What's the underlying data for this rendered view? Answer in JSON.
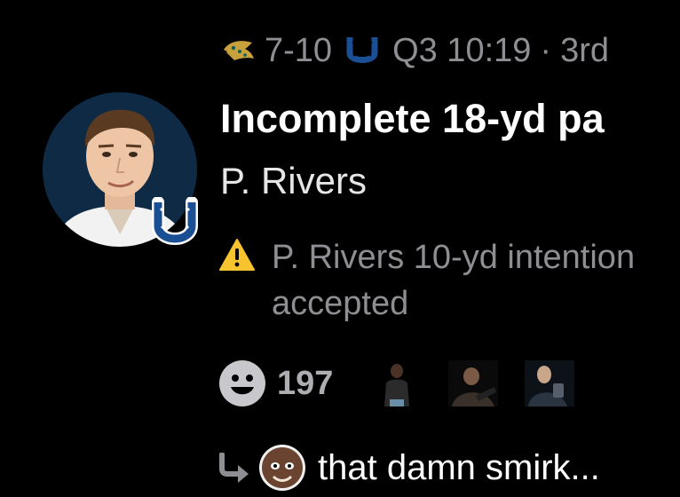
{
  "score": {
    "away_team_icon": "jaguars-logo-icon",
    "score_text": "7-10",
    "home_team_icon": "colts-horseshoe-icon",
    "quarter_clock": "Q3 10:19",
    "separator": "·",
    "down_text": "3rd"
  },
  "play": {
    "headline": "Incomplete 18-yd pa",
    "player_name": "P. Rivers",
    "player_avatar_icon": "player-headshot",
    "team_badge_icon": "colts-horseshoe-icon",
    "penalty_icon": "warning-icon",
    "penalty_line1": "P. Rivers 10-yd intention",
    "penalty_line2": "accepted"
  },
  "reactions": {
    "react_icon": "smiley-face-icon",
    "count": "197",
    "gifs": [
      "reaction-gif-thumbnail-1",
      "reaction-gif-thumbnail-2",
      "reaction-gif-thumbnail-3"
    ]
  },
  "reply": {
    "reply_icon": "reply-arrow-icon",
    "author_avatar": "reply-author-avatar",
    "text": "that damn smirk..."
  },
  "colors": {
    "background": "#000000",
    "primary_text": "#ffffff",
    "secondary_text": "#8e8e93",
    "colts_blue": "#1a4f93",
    "warning_yellow": "#f7c32e"
  }
}
